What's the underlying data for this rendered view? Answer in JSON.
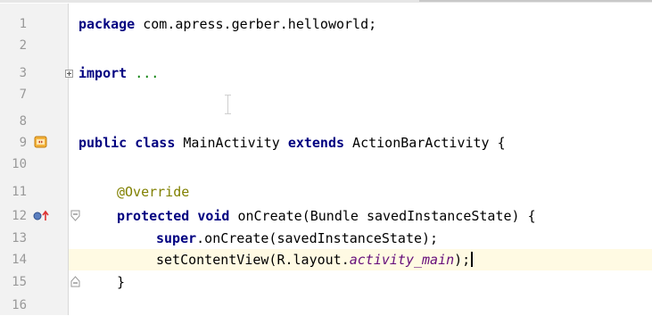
{
  "editor": {
    "lines": [
      {
        "n": "1"
      },
      {
        "n": "2"
      },
      {
        "n": "3"
      },
      {
        "n": "7"
      },
      {
        "n": "8"
      },
      {
        "n": "9"
      },
      {
        "n": "10"
      },
      {
        "n": "11"
      },
      {
        "n": "12"
      },
      {
        "n": "13"
      },
      {
        "n": "14"
      },
      {
        "n": "15"
      },
      {
        "n": "16"
      }
    ],
    "code": {
      "l1": {
        "kw": "package",
        "rest": " com.apress.gerber.helloworld;"
      },
      "l3": {
        "kw": "import",
        "dots": " ..."
      },
      "l9": {
        "kw1": "public",
        "kw2": "class",
        "name": " MainActivity ",
        "kw3": "extends",
        "rest": " ActionBarActivity {"
      },
      "l11": {
        "ann": "@Override"
      },
      "l12": {
        "kw1": "protected",
        "kw2": "void",
        "rest": " onCreate(Bundle savedInstanceState) {"
      },
      "l13": {
        "kw": "super",
        "rest": ".onCreate(savedInstanceState);"
      },
      "l14": {
        "pre": "setContentView(R.layout.",
        "field": "activity_main",
        "post": ");"
      },
      "l15": {
        "brace": "}"
      }
    },
    "current_line_highlight": "#fffae3",
    "gutter_icons": {
      "line9": "class-implementation-icon",
      "line12": "override-icon"
    }
  }
}
